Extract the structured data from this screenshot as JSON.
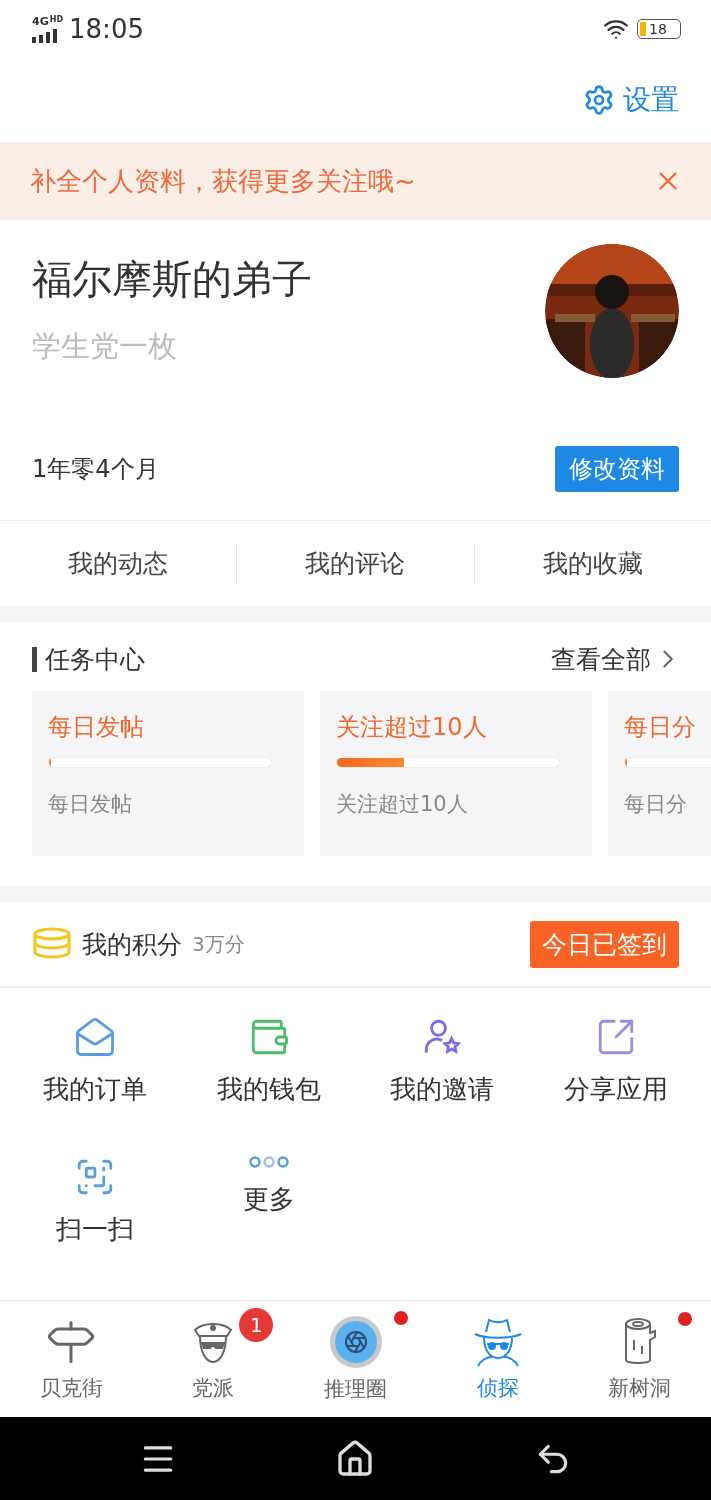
{
  "status_bar": {
    "network": "4G",
    "hd": "HD",
    "time": "18:05",
    "battery": "18"
  },
  "header": {
    "settings": "设置"
  },
  "banner": {
    "text": "补全个人资料，获得更多关注哦~"
  },
  "profile": {
    "name": "福尔摩斯的弟子",
    "bio": "学生党一枚",
    "duration": "1年零4个月",
    "edit_button": "修改资料"
  },
  "tabs": [
    {
      "label": "我的动态"
    },
    {
      "label": "我的评论"
    },
    {
      "label": "我的收藏"
    }
  ],
  "task_center": {
    "title": "任务中心",
    "view_all": "查看全部",
    "tasks": [
      {
        "title": "每日发帖",
        "level": 0,
        "description": "每日发帖"
      },
      {
        "title": "关注超过10人",
        "level": 0.3,
        "description": "关注超过10人"
      },
      {
        "title": "每日分",
        "level": 0,
        "description": "每日分"
      }
    ]
  },
  "points": {
    "label": "我的积分",
    "value": "3万分",
    "checkin_button": "今日已签到"
  },
  "menu": [
    {
      "label": "我的订单"
    },
    {
      "label": "我的钱包"
    },
    {
      "label": "我的邀请"
    },
    {
      "label": "分享应用"
    },
    {
      "label": "扫一扫"
    },
    {
      "label": "更多"
    }
  ],
  "bottom_nav": [
    {
      "label": "贝克街",
      "selected": false,
      "dot": false
    },
    {
      "label": "党派",
      "selected": false,
      "dot": false,
      "badge": "1"
    },
    {
      "label": "推理圈",
      "selected": false,
      "dot": true
    },
    {
      "label": "侦探",
      "selected": true,
      "dot": false
    },
    {
      "label": "新树洞",
      "selected": false,
      "dot": true
    }
  ]
}
